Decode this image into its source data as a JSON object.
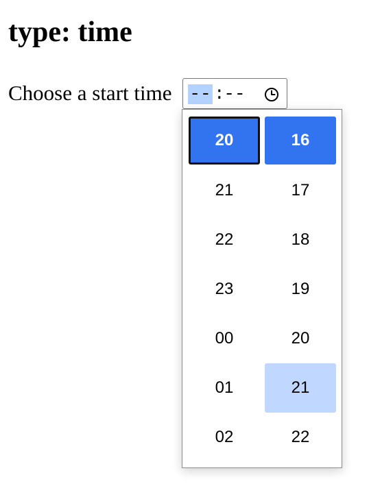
{
  "page": {
    "heading": "type: time",
    "label": "Choose a start time"
  },
  "time_input": {
    "hours_placeholder": "--",
    "separator": ":",
    "minutes_placeholder": "--",
    "icon": "clock-icon"
  },
  "picker": {
    "hours": [
      "20",
      "21",
      "22",
      "23",
      "00",
      "01",
      "02"
    ],
    "minutes": [
      "16",
      "17",
      "18",
      "19",
      "20",
      "21",
      "22"
    ],
    "selected_hour": "20",
    "selected_minute": "16",
    "hovered_minute": "21"
  },
  "colors": {
    "selected_bg": "#3274f0",
    "hover_bg": "#c0d8ff",
    "active_segment_bg": "#b4d2ff"
  }
}
